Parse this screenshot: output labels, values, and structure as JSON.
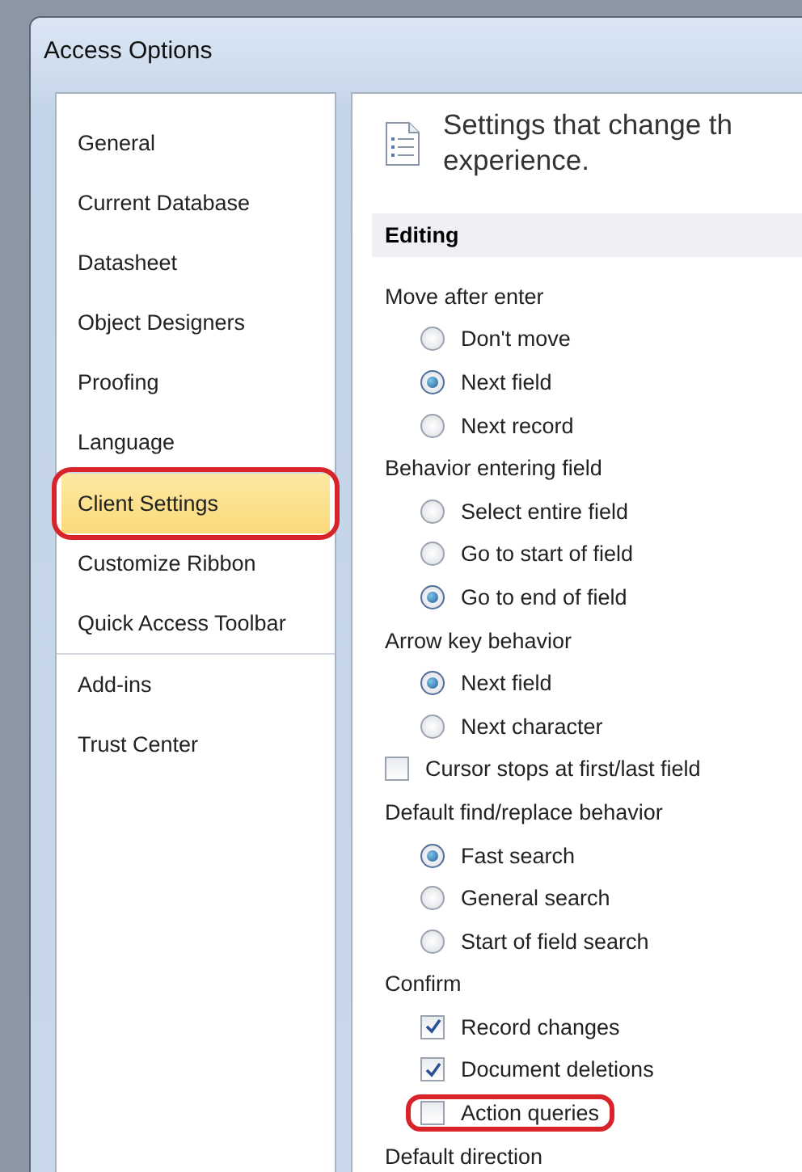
{
  "window": {
    "title": "Access Options"
  },
  "nav": {
    "groups": [
      [
        {
          "label": "General",
          "selected": false,
          "annotated": false
        },
        {
          "label": "Current Database",
          "selected": false,
          "annotated": false
        },
        {
          "label": "Datasheet",
          "selected": false,
          "annotated": false
        },
        {
          "label": "Object Designers",
          "selected": false,
          "annotated": false
        },
        {
          "label": "Proofing",
          "selected": false,
          "annotated": false
        },
        {
          "label": "Language",
          "selected": false,
          "annotated": false
        }
      ],
      [
        {
          "label": "Client Settings",
          "selected": true,
          "annotated": true
        },
        {
          "label": "Customize Ribbon",
          "selected": false,
          "annotated": false
        },
        {
          "label": "Quick Access Toolbar",
          "selected": false,
          "annotated": false
        }
      ],
      [
        {
          "label": "Add-ins",
          "selected": false,
          "annotated": false
        },
        {
          "label": "Trust Center",
          "selected": false,
          "annotated": false
        }
      ]
    ]
  },
  "header": {
    "text": "Settings that change th",
    "text_line2": "experience."
  },
  "section": {
    "title": "Editing"
  },
  "options": [
    {
      "kind": "group",
      "label": "Move after enter"
    },
    {
      "kind": "radio",
      "label": "Don't move",
      "selected": false
    },
    {
      "kind": "radio",
      "label": "Next field",
      "selected": true
    },
    {
      "kind": "radio",
      "label": "Next record",
      "selected": false
    },
    {
      "kind": "group",
      "label": "Behavior entering field"
    },
    {
      "kind": "radio",
      "label": "Select entire field",
      "selected": false
    },
    {
      "kind": "radio",
      "label": "Go to start of field",
      "selected": false
    },
    {
      "kind": "radio",
      "label": "Go to end of field",
      "selected": true
    },
    {
      "kind": "group",
      "label": "Arrow key behavior"
    },
    {
      "kind": "radio",
      "label": "Next field",
      "selected": true
    },
    {
      "kind": "radio",
      "label": "Next character",
      "selected": false
    },
    {
      "kind": "check",
      "label": "Cursor stops at first/last field",
      "checked": false,
      "annotated": false
    },
    {
      "kind": "group",
      "label": "Default find/replace behavior"
    },
    {
      "kind": "radio",
      "label": "Fast search",
      "selected": true
    },
    {
      "kind": "radio",
      "label": "General search",
      "selected": false
    },
    {
      "kind": "radio",
      "label": "Start of field search",
      "selected": false
    },
    {
      "kind": "group",
      "label": "Confirm"
    },
    {
      "kind": "subcheck",
      "label": "Record changes",
      "checked": true,
      "annotated": false
    },
    {
      "kind": "subcheck",
      "label": "Document deletions",
      "checked": true,
      "annotated": false
    },
    {
      "kind": "subcheck",
      "label": "Action queries",
      "checked": false,
      "annotated": true
    },
    {
      "kind": "group",
      "label": "Default direction"
    }
  ]
}
